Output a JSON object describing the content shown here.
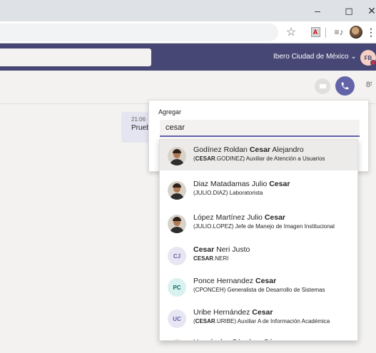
{
  "window": {
    "minimize_glyph": "–",
    "maximize_glyph": "◻",
    "close_glyph": "✕"
  },
  "toolbar": {
    "icons": [
      "star-icon",
      "pdf-extension-icon",
      "media-control-icon",
      "profile-avatar",
      "more-menu-icon"
    ]
  },
  "header": {
    "org_name": "Ibero Ciudad de México ⌄",
    "user_initials": "FB",
    "status_color": "#c4314b"
  },
  "chat": {
    "message_time": "21:06",
    "message_text": "Prueb"
  },
  "add_panel": {
    "label": "Agregar",
    "input_value": "cesar"
  },
  "suggestions": [
    {
      "pre": "Godínez Roldan ",
      "bold": "Cesar",
      "post": " Alejandro",
      "sub_pre": "(",
      "sub_bold": "CESAR",
      "sub_post": ".GODINEZ) Auxiliar de Atención a Usuarios",
      "avatar": "photo",
      "active": true
    },
    {
      "pre": "Diaz Matadamas Julio ",
      "bold": "Cesar",
      "post": "",
      "sub_pre": "(JULIO.DIAZ) Laboratorista",
      "sub_bold": "",
      "sub_post": "",
      "avatar": "photo",
      "active": false
    },
    {
      "pre": "López Martínez Julio ",
      "bold": "Cesar",
      "post": "",
      "sub_pre": "(JULIO.LOPEZ) Jefe de Manejo de Imagen Institucional",
      "sub_bold": "",
      "sub_post": "",
      "avatar": "photo",
      "active": false
    },
    {
      "pre": "",
      "bold": "Cesar",
      "post": " Neri Justo",
      "sub_pre": "",
      "sub_bold": "CESAR",
      "sub_post": ".NERI",
      "avatar": "CJ",
      "avatar_bg": "#e8e6f3",
      "avatar_fg": "#6264a7",
      "active": false
    },
    {
      "pre": "Ponce Hernandez ",
      "bold": "Cesar",
      "post": "",
      "sub_pre": "(CPONCEH) Generalista de Desarrollo de Sistemas",
      "sub_bold": "",
      "sub_post": "",
      "avatar": "PC",
      "avatar_bg": "#d9f2f0",
      "avatar_fg": "#0b6a65",
      "active": false
    },
    {
      "pre": "Uribe Hernández ",
      "bold": "Cesar",
      "post": "",
      "sub_pre": "(",
      "sub_bold": "CESAR",
      "sub_post": ".URIBE) Auxiliar A de Información Académica",
      "avatar": "UC",
      "avatar_bg": "#e8e6f3",
      "avatar_fg": "#6264a7",
      "active": false
    },
    {
      "pre": "Hernández Sánchez César",
      "bold": "",
      "post": "",
      "sub_pre": "",
      "sub_bold": "",
      "sub_post": "",
      "avatar": "photo",
      "active": false
    }
  ]
}
